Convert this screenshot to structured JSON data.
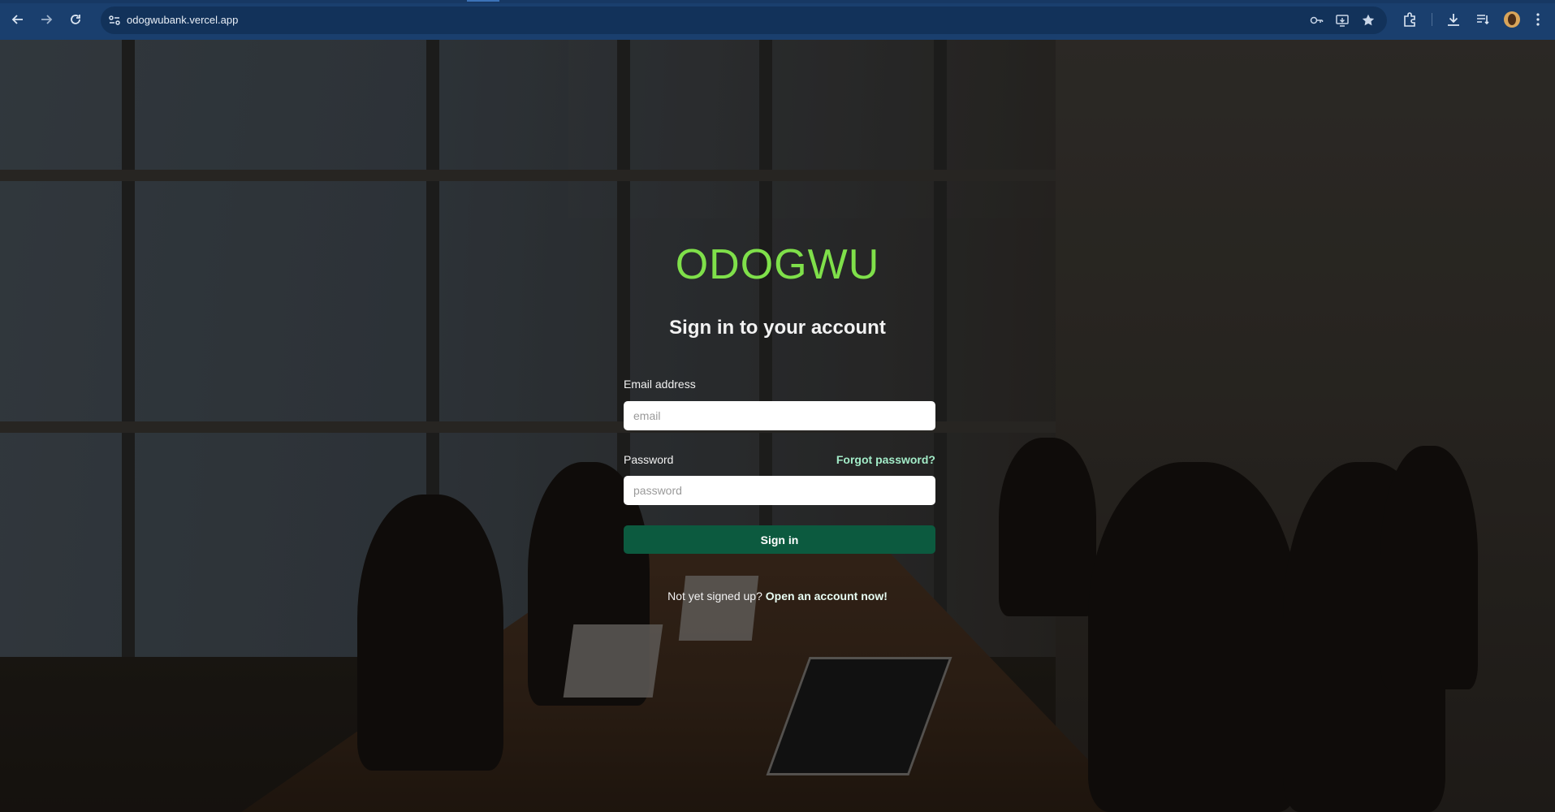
{
  "browser": {
    "url": "odogwubank.vercel.app",
    "icons": [
      "back-icon",
      "forward-icon",
      "reload-icon",
      "site-info-icon",
      "password-key-icon",
      "install-app-icon",
      "bookmark-star-icon",
      "extensions-icon",
      "download-icon",
      "reading-list-icon",
      "profile-avatar",
      "more-menu-icon"
    ]
  },
  "page": {
    "brand": "ODOGWU",
    "heading": "Sign in to your account",
    "email": {
      "label": "Email address",
      "placeholder": "email",
      "value": ""
    },
    "password": {
      "label": "Password",
      "placeholder": "password",
      "value": ""
    },
    "forgot_link": "Forgot password?",
    "submit_label": "Sign in",
    "signup_prompt": "Not yet signed up?",
    "signup_link": "Open an account now!"
  },
  "colors": {
    "brand": "#7fe04a",
    "primary_button": "#0c5a3f",
    "link": "#a3ecc8",
    "browser_bar": "#1a3f6e"
  }
}
